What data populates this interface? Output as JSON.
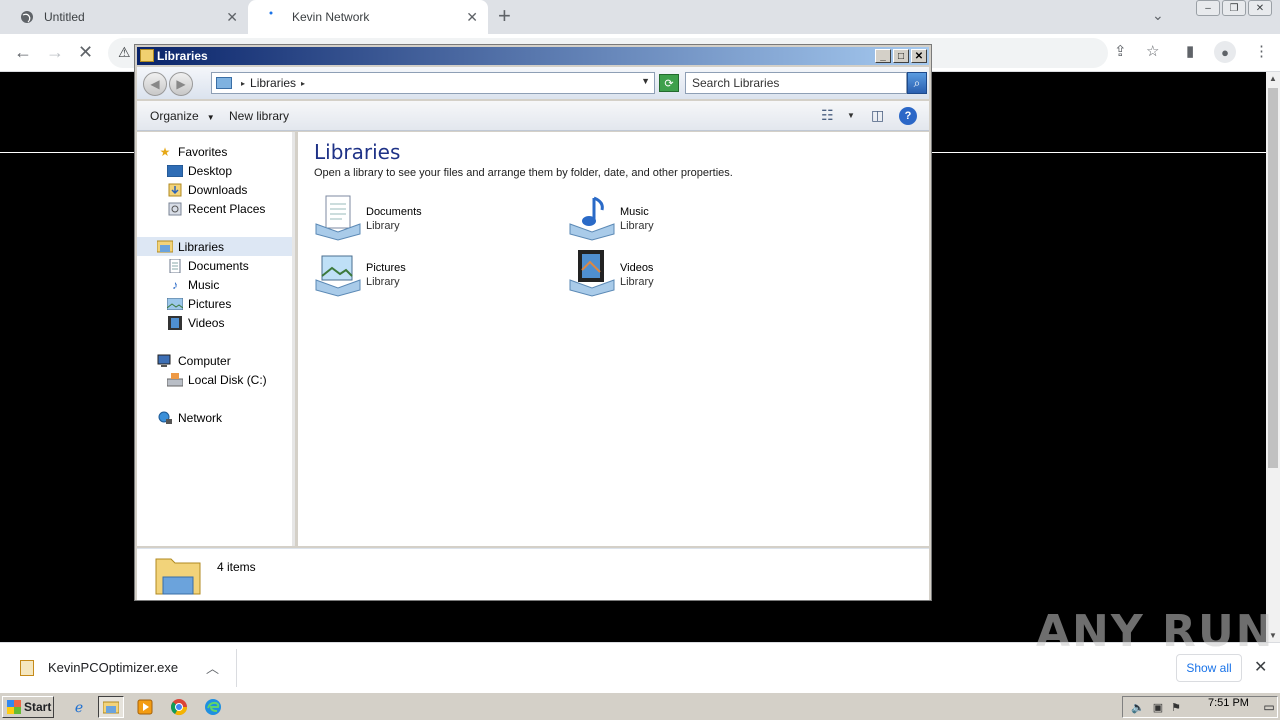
{
  "browser": {
    "tabs": [
      {
        "title": "Untitled",
        "close": "✕"
      },
      {
        "title": "Kevin Network",
        "close": "✕"
      }
    ],
    "new_tab": "+",
    "tab_search": "⌄"
  },
  "explorer": {
    "title": "Libraries",
    "address": "Libraries",
    "search_placeholder": "Search Libraries",
    "commands": {
      "organize": "Organize",
      "new_library": "New library",
      "help": "?"
    },
    "nav": {
      "favorites": "Favorites",
      "desktop": "Desktop",
      "downloads": "Downloads",
      "recent_places": "Recent Places",
      "libraries": "Libraries",
      "documents": "Documents",
      "music": "Music",
      "pictures": "Pictures",
      "videos": "Videos",
      "computer": "Computer",
      "local_disk": "Local Disk (C:)",
      "network": "Network"
    },
    "content": {
      "heading": "Libraries",
      "description": "Open a library to see your files and arrange them by folder, date, and other properties.",
      "libraries": [
        {
          "name": "Documents",
          "type": "Library"
        },
        {
          "name": "Music",
          "type": "Library"
        },
        {
          "name": "Pictures",
          "type": "Library"
        },
        {
          "name": "Videos",
          "type": "Library"
        }
      ]
    },
    "status": "4 items"
  },
  "download_shelf": {
    "file_name": "KevinPCOptimizer.exe",
    "show_all": "Show all"
  },
  "watermark": "ANY RUN",
  "taskbar": {
    "start": "Start",
    "clock": "7:51 PM"
  }
}
